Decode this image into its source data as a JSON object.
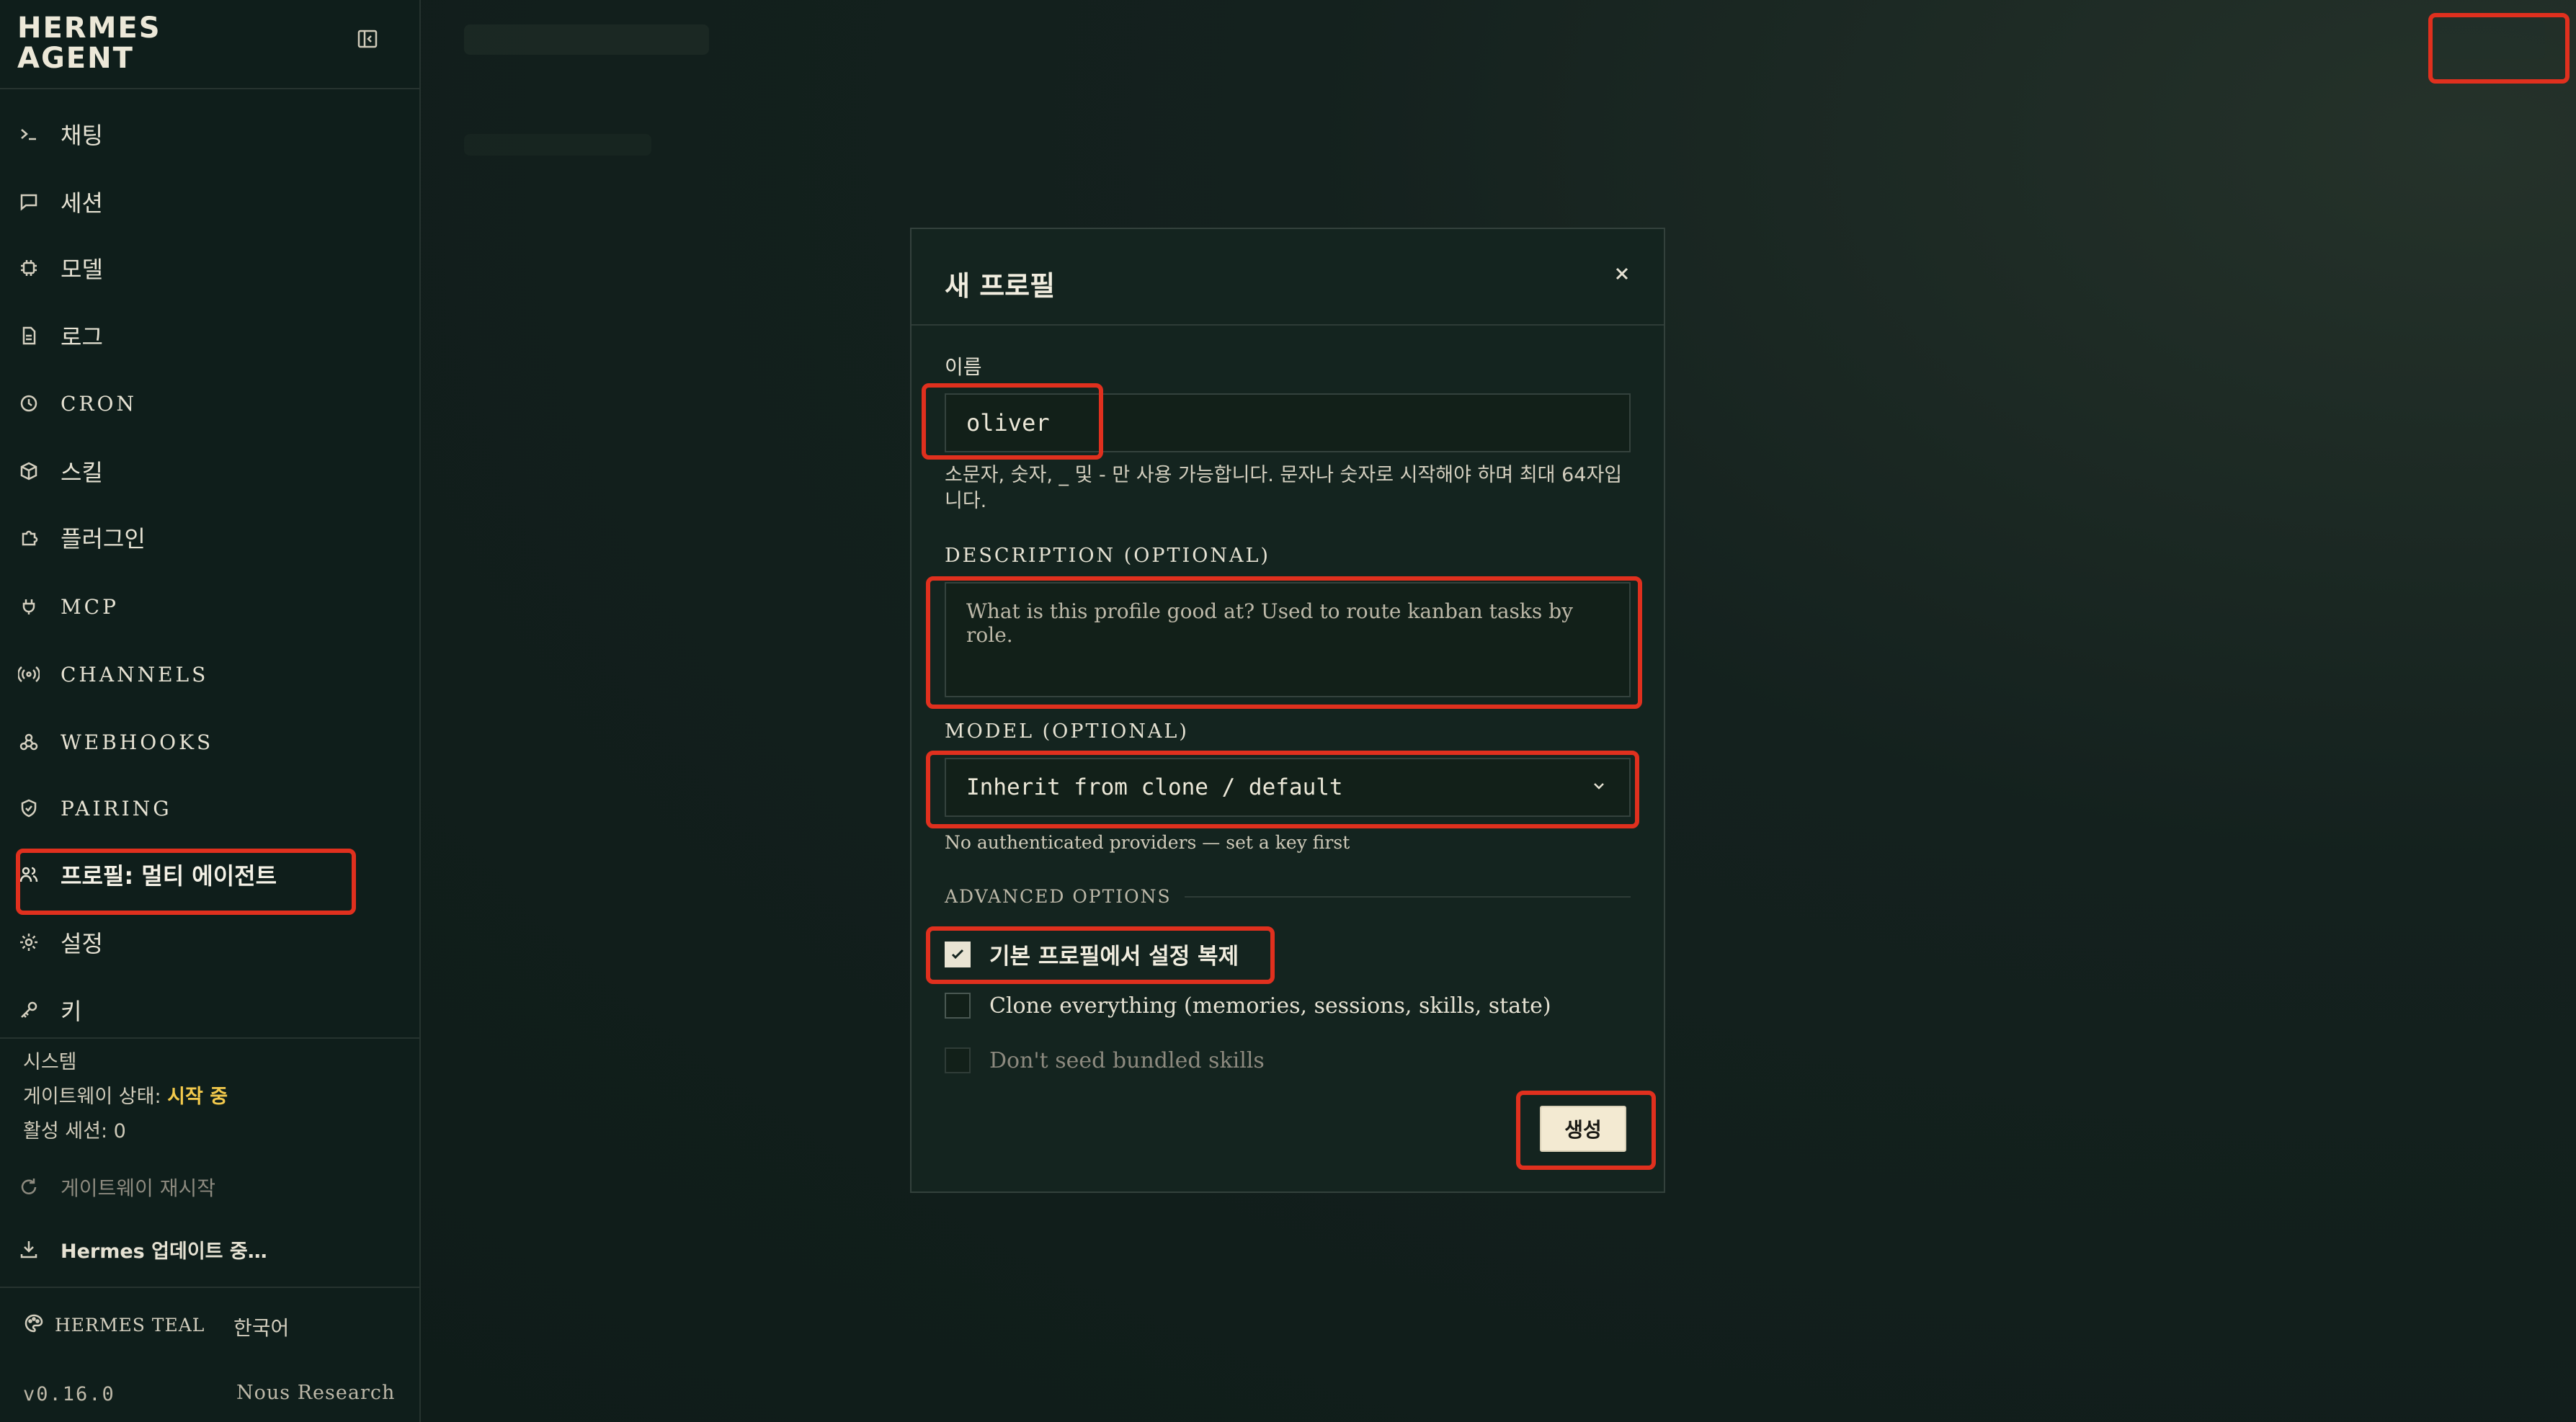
{
  "brand": {
    "line1": "HERMES",
    "line2": "AGENT"
  },
  "nav": [
    {
      "label": "채팅",
      "icon": "terminal-icon",
      "caps": false
    },
    {
      "label": "세션",
      "icon": "chat-bubble-icon",
      "caps": false
    },
    {
      "label": "모델",
      "icon": "chip-icon",
      "caps": false
    },
    {
      "label": "로그",
      "icon": "file-icon",
      "caps": false
    },
    {
      "label": "CRON",
      "icon": "clock-icon",
      "caps": true
    },
    {
      "label": "스킬",
      "icon": "package-icon",
      "caps": false
    },
    {
      "label": "플러그인",
      "icon": "puzzle-icon",
      "caps": false
    },
    {
      "label": "MCP",
      "icon": "plug-icon",
      "caps": true
    },
    {
      "label": "CHANNELS",
      "icon": "radio-icon",
      "caps": true
    },
    {
      "label": "WEBHOOKS",
      "icon": "webhook-icon",
      "caps": true
    },
    {
      "label": "PAIRING",
      "icon": "shield-check-icon",
      "caps": true
    },
    {
      "label": "프로필: 멀티 에이전트",
      "icon": "users-icon",
      "caps": false
    },
    {
      "label": "설정",
      "icon": "gear-icon",
      "caps": false
    },
    {
      "label": "키",
      "icon": "key-icon",
      "caps": false
    }
  ],
  "system": {
    "heading": "시스템",
    "gateway_label": "게이트웨이 상태: ",
    "gateway_status": "시작 중",
    "sessions": "활성 세션: 0",
    "restart": "게이트웨이 재시작",
    "update": "Hermes 업데이트 중…"
  },
  "footer": {
    "theme": "HERMES TEAL",
    "language": "한국어",
    "version": "v0.16.0",
    "company": "Nous Research"
  },
  "modal": {
    "title": "새 프로필",
    "name_label": "이름",
    "name_value": "oliver",
    "name_help": "소문자, 숫자, _ 및 - 만 사용 가능합니다. 문자나 숫자로 시작해야 하며 최대 64자입니다.",
    "desc_label": "DESCRIPTION (OPTIONAL)",
    "desc_placeholder": "What is this profile good at? Used to route kanban tasks by role.",
    "model_label": "MODEL (OPTIONAL)",
    "model_value": "Inherit from clone / default",
    "model_help": "No authenticated providers — set a key first",
    "advanced_label": "ADVANCED OPTIONS",
    "opt_clone_config": "기본 프로필에서 설정 복제",
    "opt_clone_all": "Clone everything (memories, sessions, skills, state)",
    "opt_no_seed": "Don't seed bundled skills",
    "create": "생성"
  },
  "colors": {
    "accent_warning": "#f2c94c",
    "highlight": "#e0301e",
    "button_bg": "#f3ead2"
  }
}
